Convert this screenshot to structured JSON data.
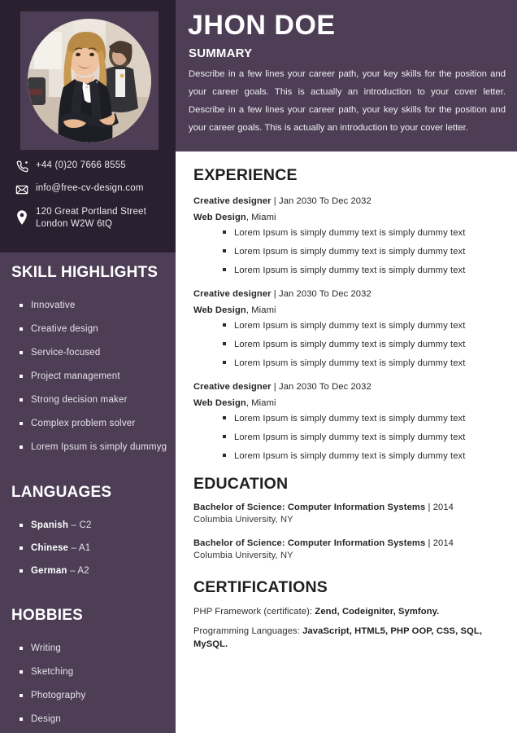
{
  "header": {
    "name": "JHON DOE",
    "summary_label": "SUMMARY",
    "summary_text": "Describe in a few lines your career path, your key skills for the position and your career goals. This is actually an introduction to your cover letter. Describe in a few lines your career path, your key skills for the position and your career goals. This is actually an introduction to your cover letter."
  },
  "sidebar": {
    "photo_alt": "portrait-photo",
    "contact": [
      {
        "icon": "phone-icon",
        "line1": "+44 (0)20 7666 8555",
        "line2": ""
      },
      {
        "icon": "email-icon",
        "line1": "info@free-cv-design.com",
        "line2": ""
      },
      {
        "icon": "location-icon",
        "line1": "120 Great Portland Street",
        "line2": "London W2W 6tQ"
      }
    ],
    "skills": {
      "heading": "SKILL HIGHLIGHTS",
      "items": [
        "Innovative",
        "Creative design",
        "Service-focused",
        "Project management",
        "Strong decision maker",
        "Complex problem solver",
        "Lorem Ipsum is simply dummyg"
      ]
    },
    "languages": {
      "heading": "LANGUAGES",
      "items": [
        {
          "name": "Spanish",
          "level": " – C2"
        },
        {
          "name": "Chinese",
          "level": " – A1"
        },
        {
          "name": "German",
          "level": " – A2"
        }
      ]
    },
    "hobbies": {
      "heading": "HOBBIES",
      "items": [
        "Writing",
        "Sketching",
        "Photography",
        "Design"
      ]
    }
  },
  "main": {
    "experience": {
      "heading": "EXPERIENCE",
      "jobs": [
        {
          "title": "Creative designer",
          "separator": " | ",
          "dates": "Jan 2030 To Dec 2032",
          "company": "Web Design",
          "location": ", Miami",
          "bullets": [
            "Lorem Ipsum is simply dummy text is simply dummy text",
            "Lorem Ipsum is simply dummy text is simply dummy text",
            "Lorem Ipsum is simply dummy text is simply dummy text"
          ]
        },
        {
          "title": "Creative designer",
          "separator": " | ",
          "dates": "Jan 2030 To Dec 2032",
          "company": "Web Design",
          "location": ", Miami",
          "bullets": [
            "Lorem Ipsum is simply dummy text is simply dummy text",
            "Lorem Ipsum is simply dummy text is simply dummy text",
            "Lorem Ipsum is simply dummy text is simply dummy text"
          ]
        },
        {
          "title": "Creative designer",
          "separator": " | ",
          "dates": "Jan 2030 To Dec 2032",
          "company": "Web Design",
          "location": ", Miami",
          "bullets": [
            "Lorem Ipsum is simply dummy text is simply dummy text",
            "Lorem Ipsum is simply dummy text is simply dummy text",
            "Lorem Ipsum is simply dummy text is simply dummy text"
          ]
        }
      ]
    },
    "education": {
      "heading": "EDUCATION",
      "entries": [
        {
          "degree": "Bachelor of Science: Computer Information Systems",
          "separator": " | ",
          "year": "2014",
          "school": "Columbia University, NY"
        },
        {
          "degree": "Bachelor of Science: Computer Information Systems",
          "separator": " | ",
          "year": "2014",
          "school": "Columbia University, NY"
        }
      ]
    },
    "certifications": {
      "heading": "CERTIFICATIONS",
      "lines": [
        {
          "label": "PHP Framework (certificate): ",
          "value": "Zend, Codeigniter, Symfony."
        },
        {
          "label": "Programming Languages: ",
          "value": "JavaScript, HTML5, PHP OOP, CSS, SQL, MySQL."
        }
      ]
    }
  },
  "colors": {
    "sidebar_dark": "#2a2030",
    "sidebar_light": "#4d3e56",
    "header_purple": "#4d3e56",
    "text_light": "#ffffff",
    "text_dark": "#1f1f1f"
  }
}
